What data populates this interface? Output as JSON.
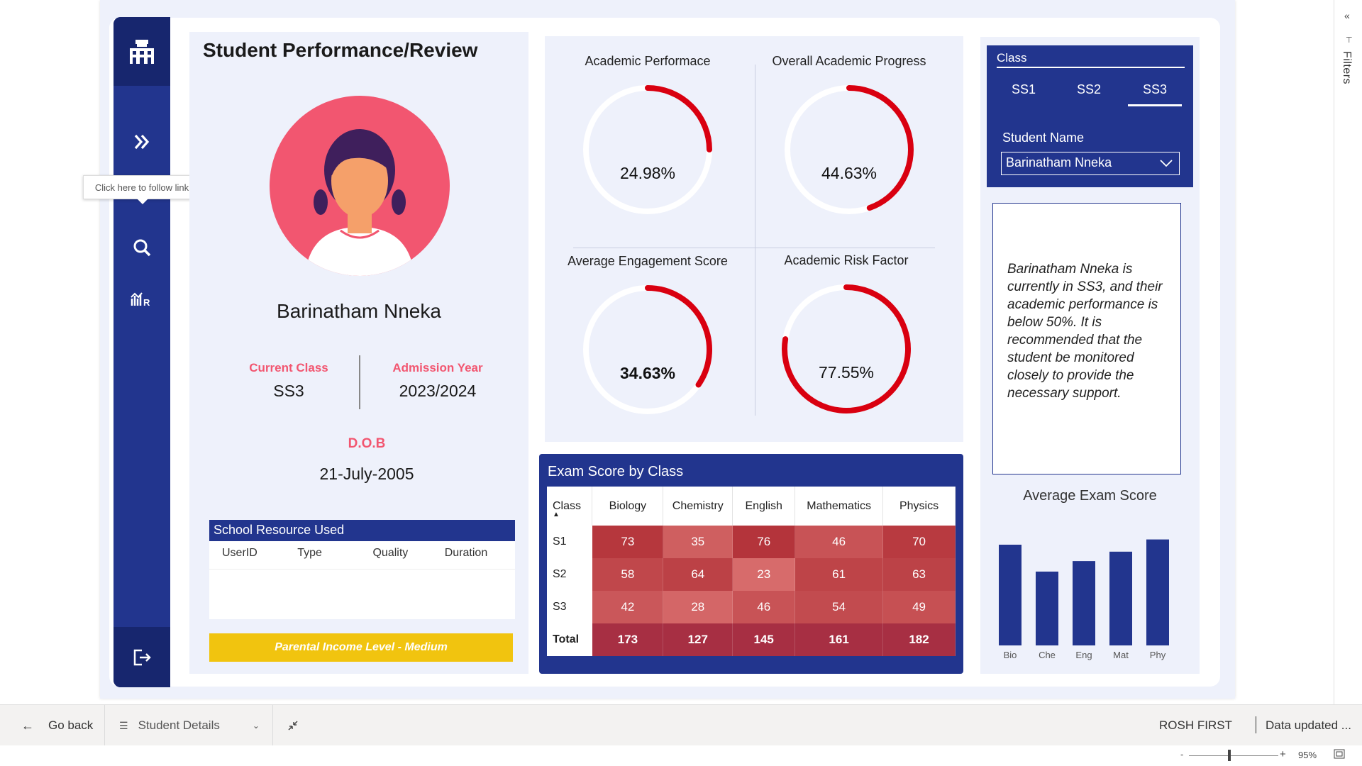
{
  "report": {
    "title": "Student Performance/Review",
    "student_name": "Barinatham Nneka",
    "current_class_label": "Current Class",
    "current_class": "SS3",
    "admission_year_label": "Admission Year",
    "admission_year": "2023/2024",
    "dob_label": "D.O.B",
    "dob": "21-July-2005",
    "resource": {
      "title": "School Resource Used",
      "columns": [
        "UserID",
        "Type",
        "Quality",
        "Duration"
      ]
    },
    "income_banner": "Parental Income Level - Medium"
  },
  "nav": {
    "tooltip": "Click here to follow link",
    "icons": [
      "school-building-icon",
      "double-chevron-right-icon",
      "info-icon",
      "search-icon",
      "analytics-icon",
      "exit-icon"
    ]
  },
  "gauges": [
    {
      "title": "Academic Performace",
      "value_text": "24.98%",
      "value": 0.2498,
      "bold": false
    },
    {
      "title": "Overall Academic Progress",
      "value_text": "44.63%",
      "value": 0.4463,
      "bold": false
    },
    {
      "title": "Average Engagement Score",
      "value_text": "34.63%",
      "value": 0.3463,
      "bold": true
    },
    {
      "title": "Academic Risk Factor",
      "value_text": "77.55%",
      "value": 0.7755,
      "bold": false
    }
  ],
  "exam": {
    "title": "Exam Score by Class",
    "corner": "Class",
    "subjects": [
      "Biology",
      "Chemistry",
      "English",
      "Mathematics",
      "Physics"
    ],
    "rows": [
      {
        "label": "S1",
        "values": [
          73,
          35,
          76,
          46,
          70
        ]
      },
      {
        "label": "S2",
        "values": [
          58,
          64,
          23,
          61,
          63
        ]
      },
      {
        "label": "S3",
        "values": [
          42,
          28,
          46,
          54,
          49
        ]
      }
    ],
    "total": {
      "label": "Total",
      "values": [
        173,
        127,
        145,
        161,
        182
      ]
    }
  },
  "slicer": {
    "title": "Class",
    "options": [
      "SS1",
      "SS2",
      "SS3"
    ],
    "selected": "SS3",
    "student_label": "Student Name",
    "student_value": "Barinatham Nneka"
  },
  "insight": "Barinatham Nneka is currently in SS3, and their academic performance is below 50%. It is recommended that the student be monitored closely to provide the necessary support.",
  "chart_data": {
    "type": "bar",
    "title": "Average Exam Score",
    "categories": [
      "Bio",
      "Che",
      "Eng",
      "Mat",
      "Phy"
    ],
    "values": [
      57.7,
      42.3,
      48.3,
      53.7,
      60.7
    ],
    "ylim": [
      0,
      65
    ],
    "color": "#22358e",
    "grid": false
  },
  "filters": {
    "label": "Filters"
  },
  "bottom_bar": {
    "go_back": "Go back",
    "page_name": "Student Details",
    "workspace": "ROSH FIRST",
    "data_updated": "Data updated ...",
    "zoom": "95%",
    "zoom_minus": "-",
    "zoom_plus": "+"
  },
  "colors": {
    "navy": "#22358e",
    "pink": "#f25670",
    "red_gauge": "#d90010",
    "yellow": "#f1c40f"
  }
}
